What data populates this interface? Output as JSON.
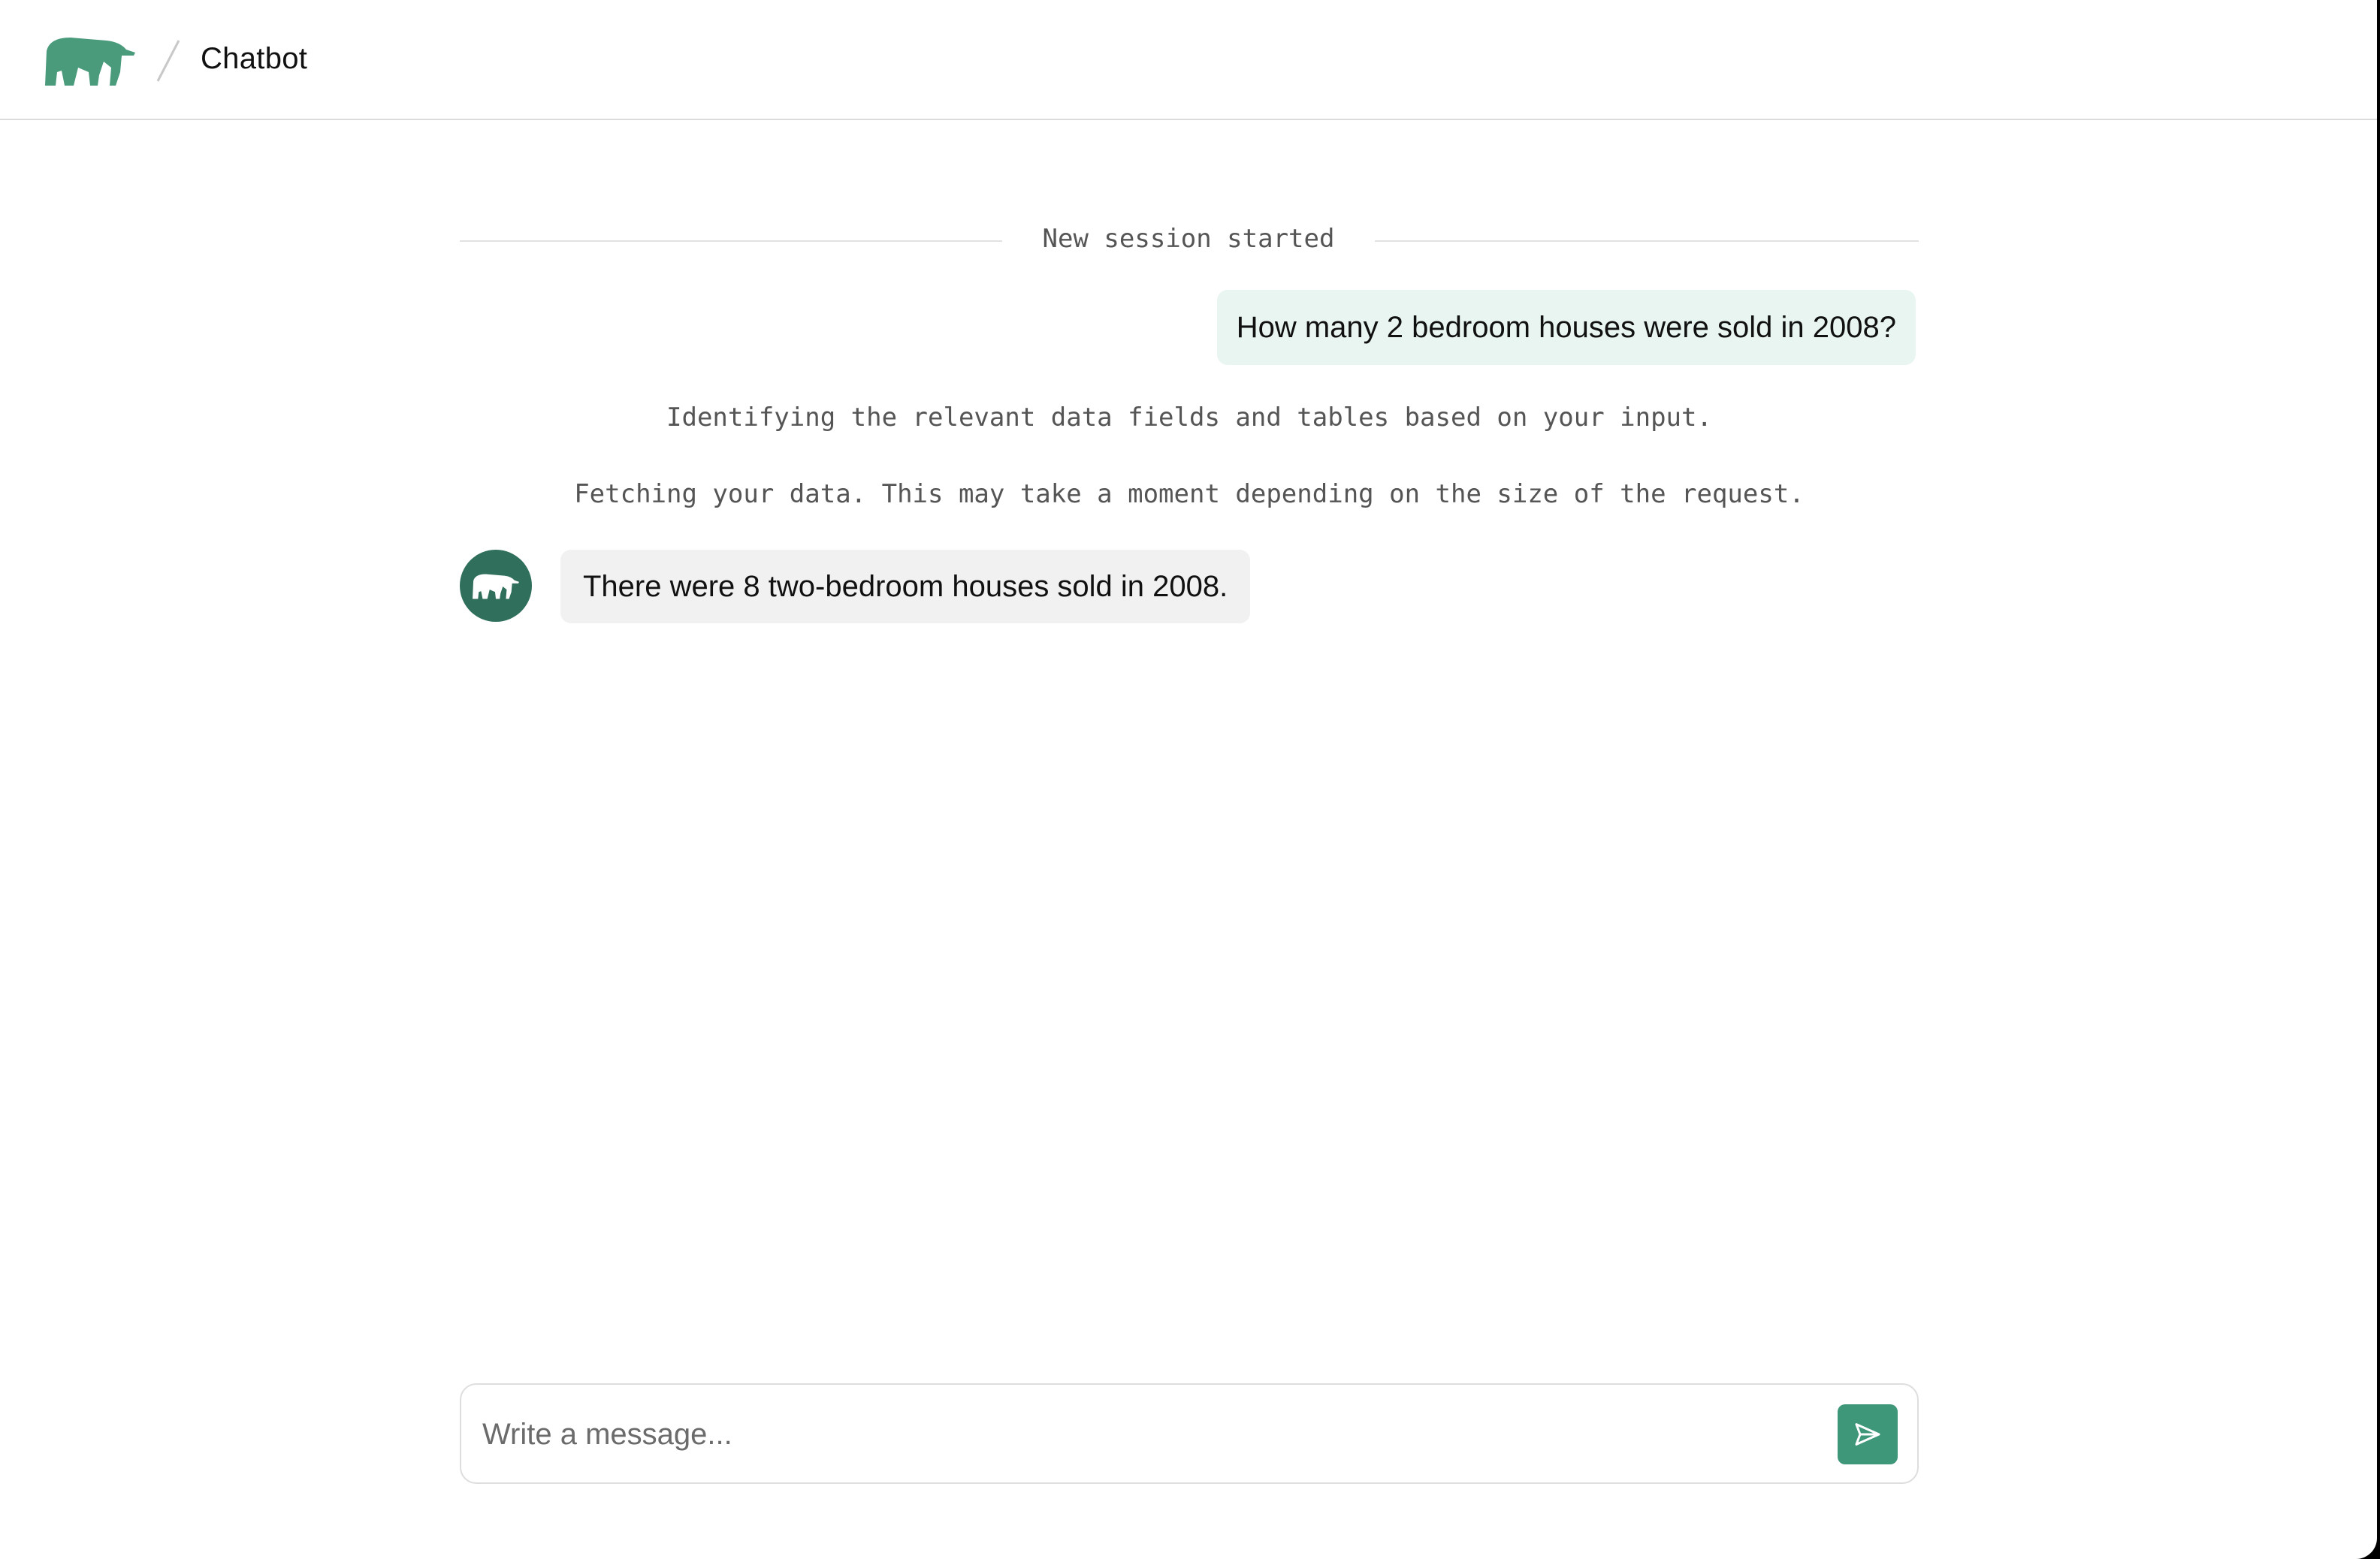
{
  "header": {
    "app_title": "Chatbot",
    "logo_icon": "anteater-logo-icon"
  },
  "chat": {
    "session_divider": "New session started",
    "messages": [
      {
        "role": "user",
        "text": "How many 2 bedroom houses were sold in 2008?"
      },
      {
        "role": "status",
        "text": "Identifying the relevant data fields and tables based on your input."
      },
      {
        "role": "status",
        "text": "Fetching your data. This may take a moment depending on the size of the request."
      },
      {
        "role": "assistant",
        "text": "There were 8 two-bedroom houses sold in 2008.",
        "avatar_icon": "anteater-avatar-icon"
      }
    ]
  },
  "composer": {
    "placeholder": "Write a message...",
    "value": "",
    "send_icon": "send-icon"
  },
  "colors": {
    "brand_green": "#4a9a7c",
    "avatar_green": "#2f6f5c",
    "send_button": "#3f9779",
    "user_bubble": "#e8f5f1",
    "assistant_bubble": "#f1f1f1"
  }
}
